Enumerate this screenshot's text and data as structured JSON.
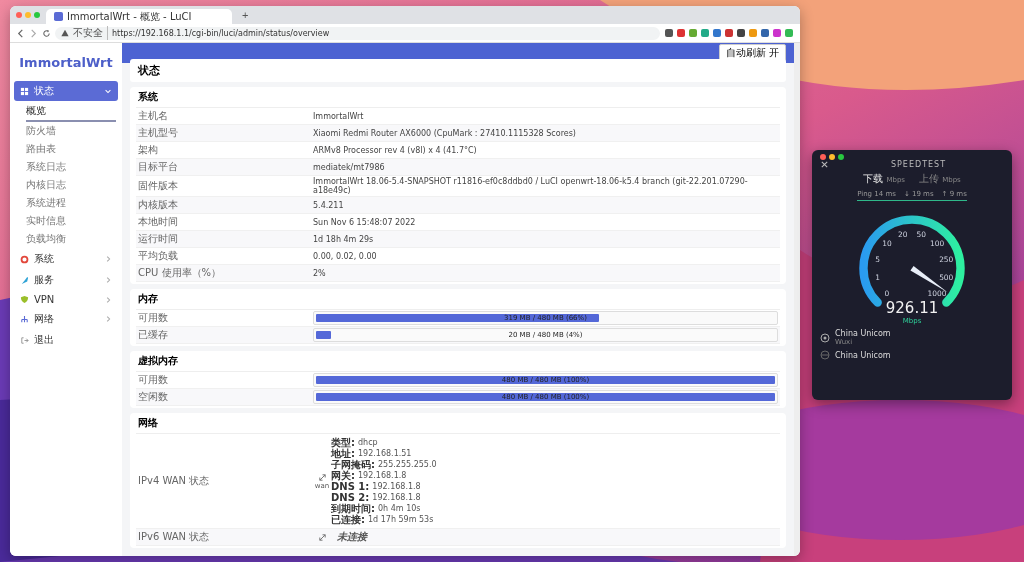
{
  "browser": {
    "tab_title": "ImmortalWrt - 概览 - LuCI",
    "new_tab": "+",
    "security": "不安全",
    "url": "https://192.168.1.1/cgi-bin/luci/admin/status/overview"
  },
  "app": {
    "logo": "ImmortalWrt",
    "auto_refresh": "自动刷新 开",
    "page_title": "状态",
    "sidebar": [
      {
        "label": "状态",
        "expanded": true,
        "children": [
          {
            "label": "概览",
            "selected": true
          },
          {
            "label": "防火墙",
            "selected": false
          },
          {
            "label": "路由表",
            "selected": false
          },
          {
            "label": "系统日志",
            "selected": false
          },
          {
            "label": "内核日志",
            "selected": false
          },
          {
            "label": "系统进程",
            "selected": false
          },
          {
            "label": "实时信息",
            "selected": false
          },
          {
            "label": "负载均衡",
            "selected": false
          }
        ]
      },
      {
        "label": "系统",
        "expanded": false
      },
      {
        "label": "服务",
        "expanded": false
      },
      {
        "label": "VPN",
        "expanded": false
      },
      {
        "label": "网络",
        "expanded": false
      },
      {
        "label": "退出"
      }
    ],
    "system": {
      "title": "系统",
      "rows": [
        {
          "label": "主机名",
          "value": "ImmortalWrt"
        },
        {
          "label": "主机型号",
          "value": "Xiaomi Redmi Router AX6000 (CpuMark : 27410.1115328 Scores)"
        },
        {
          "label": "架构",
          "value": "ARMv8 Processor rev 4 (v8l) x 4 (41.7°C)"
        },
        {
          "label": "目标平台",
          "value": "mediatek/mt7986"
        },
        {
          "label": "固件版本",
          "value": "ImmortalWrt 18.06-5.4-SNAPSHOT r11816-ef0c8ddbd0 / LuCI openwrt-18.06-k5.4 branch (git-22.201.07290-a18e49c)"
        },
        {
          "label": "内核版本",
          "value": "5.4.211"
        },
        {
          "label": "本地时间",
          "value": "Sun Nov 6 15:48:07 2022"
        },
        {
          "label": "运行时间",
          "value": "1d 18h 4m 29s"
        },
        {
          "label": "平均负载",
          "value": "0.00, 0.02, 0.00"
        },
        {
          "label": "CPU 使用率（%）",
          "value": "2%"
        }
      ]
    },
    "memory": {
      "title": "内存",
      "rows": [
        {
          "label": "可用数",
          "value": "319 MB / 480 MB (66%)",
          "level": 0.62
        },
        {
          "label": "已缓存",
          "value": "20 MB / 480 MB (4%)",
          "level": 0.04
        }
      ]
    },
    "swap": {
      "title": "虚拟内存",
      "rows": [
        {
          "label": "可用数",
          "value": "480 MB / 480 MB (100%)",
          "level": 1
        },
        {
          "label": "空闲数",
          "value": "480 MB / 480 MB (100%)",
          "level": 1
        }
      ]
    },
    "network": {
      "title": "网络",
      "ipv4": {
        "label": "IPv4 WAN 状态",
        "iface": "wan",
        "details": [
          {
            "key": "类型:",
            "value": "dhcp"
          },
          {
            "key": "地址:",
            "value": "192.168.1.51"
          },
          {
            "key": "子网掩码:",
            "value": "255.255.255.0"
          },
          {
            "key": "网关:",
            "value": "192.168.1.8"
          },
          {
            "key": "DNS 1:",
            "value": "192.168.1.8"
          },
          {
            "key": "DNS 2:",
            "value": "192.168.1.8"
          },
          {
            "key": "到期时间:",
            "value": "0h 4m 10s"
          },
          {
            "key": "已连接:",
            "value": "1d 17h 59m 53s"
          }
        ]
      },
      "ipv6": {
        "label": "IPv6 WAN 状态",
        "status": "未连接"
      }
    }
  },
  "speedtest": {
    "title": "SPEEDTEST",
    "download": "下载",
    "download_unit": "Mbps",
    "upload": "上传",
    "upload_unit": "Mbps",
    "stats": [
      "Ping 14 ms",
      "↓ 19 ms",
      "↑ 9 ms"
    ],
    "gauge_labels": [
      "0",
      "1",
      "5",
      "10",
      "20",
      "50",
      "100",
      "250",
      "500",
      "1000"
    ],
    "speed": "926.11",
    "speed_unit": "Mbps",
    "server": {
      "name": "China Unicom",
      "location": "Wuxi"
    },
    "provider": "China Unicom"
  }
}
